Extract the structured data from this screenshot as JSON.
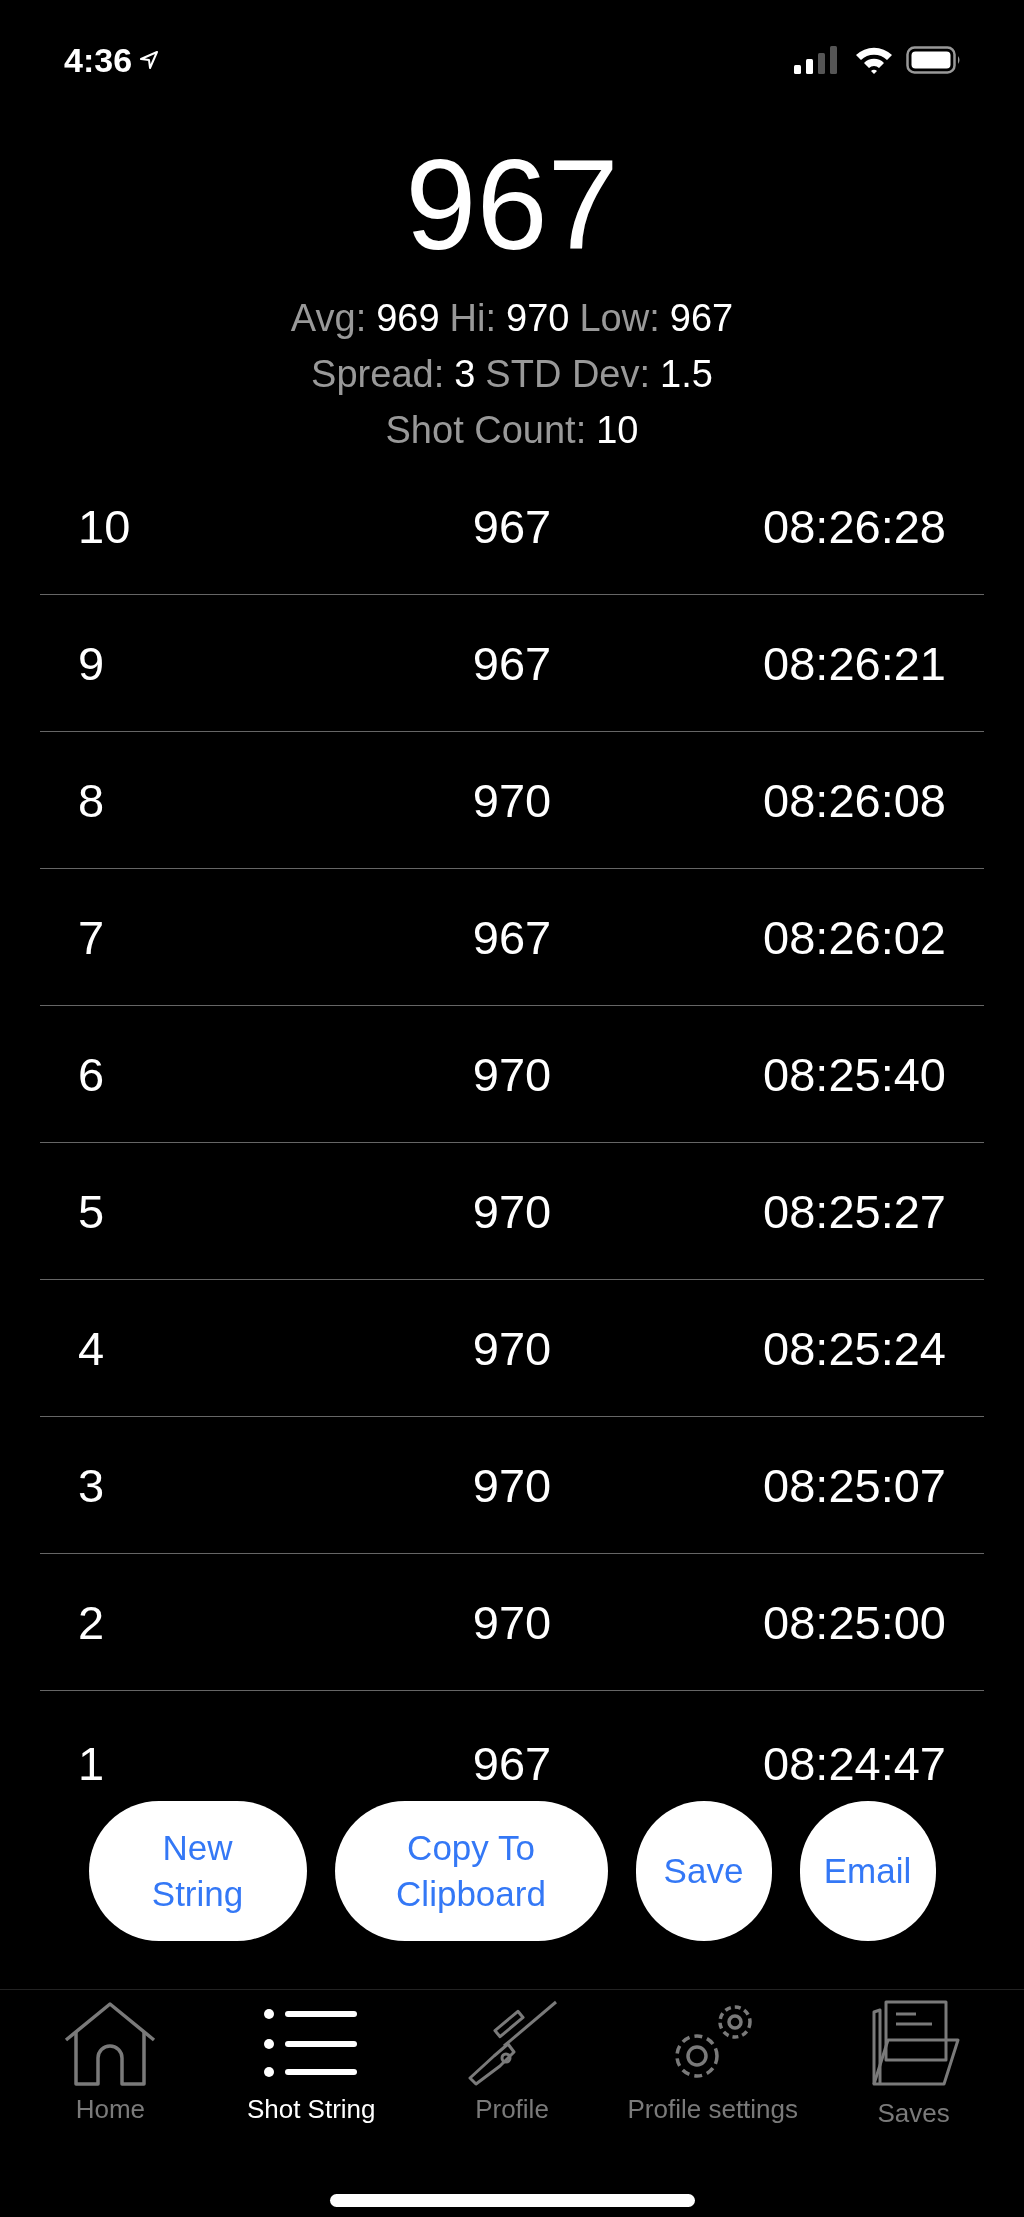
{
  "status_bar": {
    "time": "4:36"
  },
  "reading": "967",
  "stats": [
    [
      {
        "label": "Avg:",
        "value": "969"
      },
      {
        "label": "Hi:",
        "value": "970"
      },
      {
        "label": "Low:",
        "value": "967"
      }
    ],
    [
      {
        "label": "Spread:",
        "value": "3"
      },
      {
        "label": "STD Dev:",
        "value": "1.5"
      }
    ],
    [
      {
        "label": "Shot Count:",
        "value": "10"
      }
    ]
  ],
  "shots": [
    {
      "number": "10",
      "velocity": "967",
      "time": "08:26:28"
    },
    {
      "number": "9",
      "velocity": "967",
      "time": "08:26:21"
    },
    {
      "number": "8",
      "velocity": "970",
      "time": "08:26:08"
    },
    {
      "number": "7",
      "velocity": "967",
      "time": "08:26:02"
    },
    {
      "number": "6",
      "velocity": "970",
      "time": "08:25:40"
    },
    {
      "number": "5",
      "velocity": "970",
      "time": "08:25:27"
    },
    {
      "number": "4",
      "velocity": "970",
      "time": "08:25:24"
    },
    {
      "number": "3",
      "velocity": "970",
      "time": "08:25:07"
    },
    {
      "number": "2",
      "velocity": "970",
      "time": "08:25:00"
    },
    {
      "number": "1",
      "velocity": "967",
      "time": "08:24:47"
    }
  ],
  "buttons": [
    {
      "label": "New String",
      "kind": "pill"
    },
    {
      "label": "Copy To Clipboard",
      "kind": "pill"
    },
    {
      "label": "Save",
      "kind": "circle"
    },
    {
      "label": "Email",
      "kind": "circle"
    }
  ],
  "tabs": [
    {
      "label": "Home",
      "selected": false
    },
    {
      "label": "Shot String",
      "selected": true
    },
    {
      "label": "Profile",
      "selected": false
    },
    {
      "label": "Profile settings",
      "selected": false
    },
    {
      "label": "Saves",
      "selected": false
    }
  ]
}
